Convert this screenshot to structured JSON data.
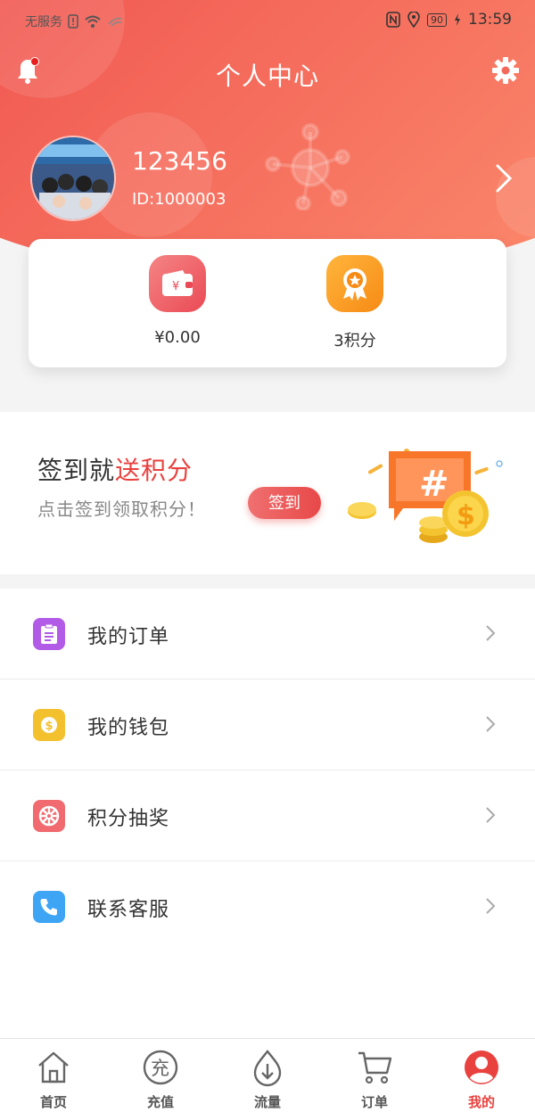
{
  "status_bar": {
    "carrier": "无服务",
    "battery": "90",
    "time": "13:59"
  },
  "header": {
    "title": "个人中心"
  },
  "profile": {
    "username": "123456",
    "user_id": "ID:1000003"
  },
  "balance_card": {
    "wallet_value": "¥0.00",
    "points_value": "3积分"
  },
  "sign_in": {
    "title_prefix": "签到就",
    "title_highlight": "送积分",
    "subtitle": "点击签到领取积分！",
    "button": "签到"
  },
  "menu": {
    "items": [
      {
        "label": "我的订单",
        "icon": "clipboard-icon",
        "color": "#b15be6"
      },
      {
        "label": "我的钱包",
        "icon": "coin-icon",
        "color": "#f3c12e"
      },
      {
        "label": "积分抽奖",
        "icon": "lottery-wheel-icon",
        "color": "#f06a6f"
      },
      {
        "label": "联系客服",
        "icon": "phone-icon",
        "color": "#3ea5f5"
      }
    ]
  },
  "tabbar": {
    "items": [
      {
        "label": "首页",
        "icon": "home-icon"
      },
      {
        "label": "充值",
        "icon": "recharge-icon"
      },
      {
        "label": "流量",
        "icon": "traffic-icon"
      },
      {
        "label": "订单",
        "icon": "cart-icon"
      },
      {
        "label": "我的",
        "icon": "user-icon",
        "active": true
      }
    ]
  },
  "colors": {
    "accent": "#e8413e",
    "header_start": "#ee4a4a",
    "header_end": "#fb8a6c"
  }
}
